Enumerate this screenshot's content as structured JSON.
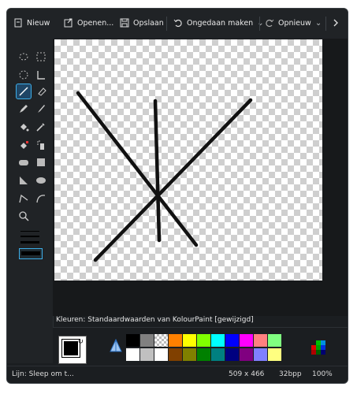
{
  "toolbar": {
    "new_label": "Nieuw",
    "open_label": "Openen...",
    "save_label": "Opslaan",
    "undo_label": "Ongedaan maken",
    "redo_label": "Opnieuw"
  },
  "colors": {
    "label": "Kleuren: Standaardwaarden van KolourPaint [gewijzigd]",
    "foreground": "#000000",
    "background": "#ffffff",
    "swatches_top": [
      "#000000",
      "#808080",
      "transparent",
      "#ff8000",
      "#ffff00",
      "#80ff00",
      "#00ffff",
      "#0000ff",
      "#ff00ff",
      "#ff8080",
      "#80ff80"
    ],
    "swatches_bottom": [
      "#ffffff",
      "#c0c0c0",
      "#ffffff",
      "#804000",
      "#808000",
      "#008000",
      "#008080",
      "#000080",
      "#800080",
      "#8080ff",
      "#ffff80"
    ]
  },
  "status": {
    "tool_text": "Lijn: Sleep om t...",
    "dimensions": "509 x 466",
    "bpp": "32bpp",
    "zoom": "100%"
  },
  "icons": [
    "new-icon",
    "open-icon",
    "save-icon",
    "undo-icon",
    "redo-icon",
    "chevron-right-icon"
  ],
  "accent": "#3daee9"
}
